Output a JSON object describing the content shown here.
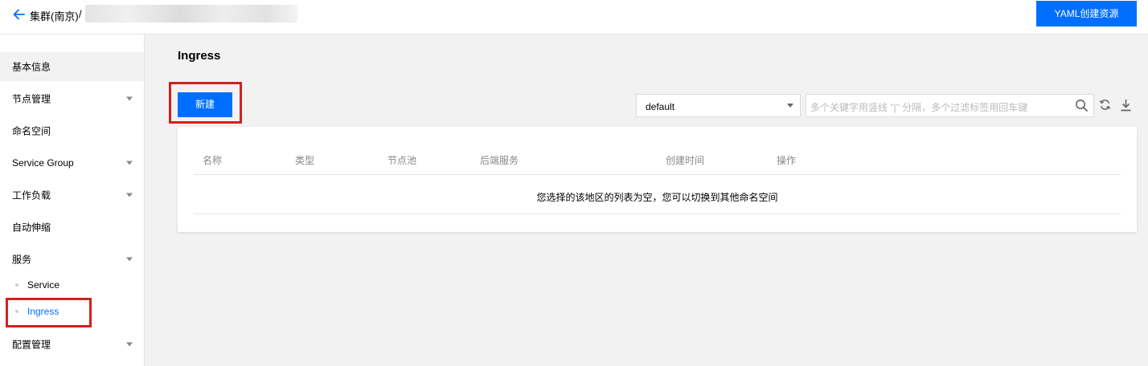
{
  "header": {
    "breadcrumb_parent": "集群(南京)",
    "breadcrumb_separator": "/",
    "yaml_button": "YAML创建资源"
  },
  "sidebar": {
    "items": [
      {
        "label": "基本信息",
        "expandable": false,
        "active": true
      },
      {
        "label": "节点管理",
        "expandable": true
      },
      {
        "label": "命名空间",
        "expandable": false
      },
      {
        "label": "Service Group",
        "expandable": true
      },
      {
        "label": "工作负载",
        "expandable": true
      },
      {
        "label": "自动伸缩",
        "expandable": false
      },
      {
        "label": "服务",
        "expandable": true,
        "expanded": true
      },
      {
        "label": "配置管理",
        "expandable": true
      }
    ],
    "service_subitems": [
      {
        "label": "Service",
        "current": false
      },
      {
        "label": "Ingress",
        "current": true
      }
    ]
  },
  "main": {
    "title": "Ingress",
    "new_button": "新建",
    "namespace_select": "default",
    "search_placeholder": "多个关键字用竖线 \"|\" 分隔，多个过滤标签用回车键",
    "table": {
      "columns": [
        "名称",
        "类型",
        "节点池",
        "后端服务",
        "创建时间",
        "操作"
      ],
      "empty_text": "您选择的该地区的列表为空，您可以切换到其他命名空间"
    }
  },
  "colors": {
    "primary": "#006eff",
    "highlight_border": "#d2211c",
    "page_background": "#f2f2f2"
  },
  "icons": [
    "back-arrow-icon",
    "chevron-down-icon",
    "search-icon",
    "refresh-icon",
    "download-icon"
  ]
}
